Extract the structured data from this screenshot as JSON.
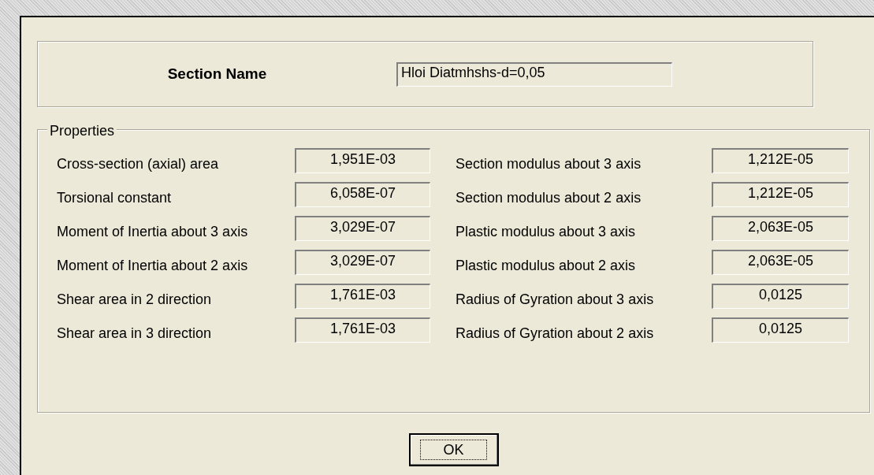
{
  "section_name": {
    "label": "Section Name",
    "value": "Hloi Diatmhshs-d=0,05"
  },
  "properties": {
    "title": "Properties",
    "left": [
      {
        "label": "Cross-section (axial) area",
        "value": "1,951E-03"
      },
      {
        "label": "Torsional constant",
        "value": "6,058E-07"
      },
      {
        "label": "Moment of Inertia about 3 axis",
        "value": "3,029E-07"
      },
      {
        "label": "Moment of Inertia about 2 axis",
        "value": "3,029E-07"
      },
      {
        "label": "Shear area in 2 direction",
        "value": "1,761E-03"
      },
      {
        "label": "Shear area in 3 direction",
        "value": "1,761E-03"
      }
    ],
    "right": [
      {
        "label": "Section modulus about 3 axis",
        "value": "1,212E-05"
      },
      {
        "label": "Section modulus about 2 axis",
        "value": "1,212E-05"
      },
      {
        "label": "Plastic modulus about 3 axis",
        "value": "2,063E-05"
      },
      {
        "label": "Plastic modulus about 2 axis",
        "value": "2,063E-05"
      },
      {
        "label": "Radius of Gyration about 3 axis",
        "value": "0,0125"
      },
      {
        "label": "Radius of Gyration about 2 axis",
        "value": "0,0125"
      }
    ]
  },
  "buttons": [
    {
      "label": "OK",
      "focused": true
    }
  ]
}
